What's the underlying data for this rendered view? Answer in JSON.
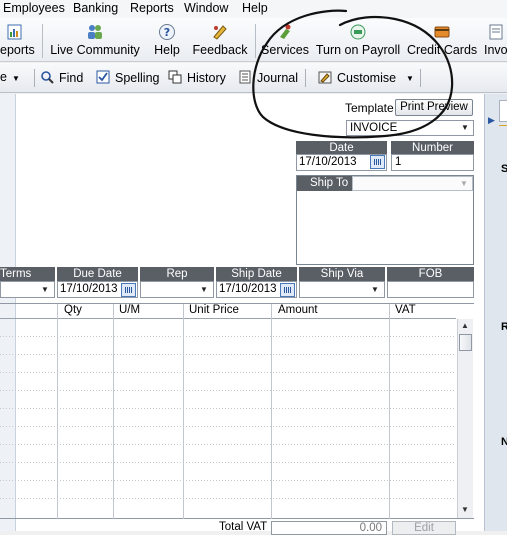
{
  "menu": [
    "Employees",
    "Banking",
    "Reports",
    "Window",
    "Help"
  ],
  "toolbar": {
    "reports": "eports",
    "live_community": "Live Community",
    "help": "Help",
    "feedback": "Feedback",
    "services": "Services",
    "payroll": "Turn on Payroll",
    "credit_cards": "Credit Cards",
    "invoice": "Invo"
  },
  "form_toolbar": {
    "e": "e",
    "find": "Find",
    "spelling": "Spelling",
    "history": "History",
    "journal": "Journal",
    "customise": "Customise"
  },
  "template": {
    "label": "Template",
    "print_preview": "Print Preview",
    "value": "INVOICE"
  },
  "header": {
    "date_label": "Date",
    "date": "17/10/2013",
    "number_label": "Number",
    "number": "1",
    "ship_to_label": "Ship To"
  },
  "terms_row": {
    "terms": "Terms",
    "due_date": "Due Date",
    "due_date_value": "17/10/2013",
    "rep": "Rep",
    "ship_date": "Ship Date",
    "ship_date_value": "17/10/2013",
    "ship_via": "Ship Via",
    "fob": "FOB"
  },
  "grid": {
    "columns": [
      "Qty",
      "U/M",
      "Unit Price",
      "Amount",
      "VAT"
    ]
  },
  "footer": {
    "total_vat": "Total VAT",
    "total_vat_value": "0.00",
    "edit": "Edit"
  },
  "side_panel": {
    "letters": [
      "S",
      "R",
      "N"
    ]
  },
  "colors": {
    "header_bg": "#5a5f66",
    "annotation": "#111111",
    "accent": "#2a56a0"
  }
}
